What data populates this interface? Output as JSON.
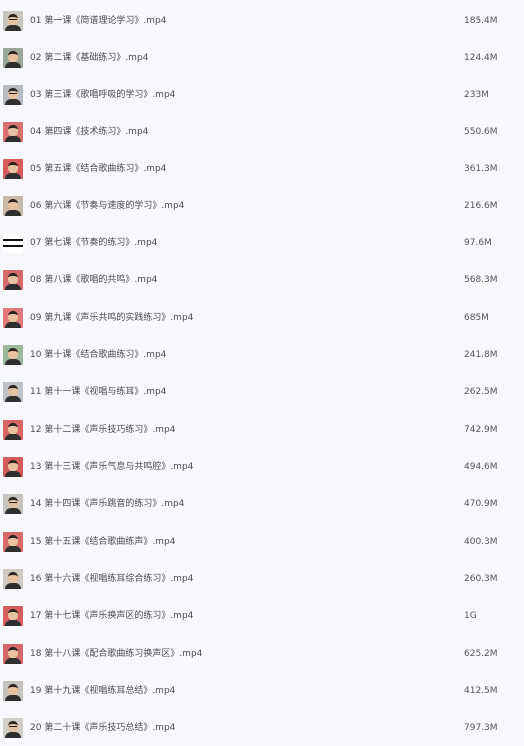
{
  "files": [
    {
      "name": "01 第一课《简谱理论学习》.mp4",
      "size": "185.4M",
      "thumb": "thumbnail-icon",
      "tone": "#c9c6c0"
    },
    {
      "name": "02 第二课《基础练习》.mp4",
      "size": "124.4M",
      "thumb": "thumbnail-icon",
      "tone": "#9aa79a"
    },
    {
      "name": "03 第三课《歌唱呼吸的学习》.mp4",
      "size": "233M",
      "thumb": "thumbnail-icon",
      "tone": "#b8bcc2"
    },
    {
      "name": "04 第四课《技术练习》.mp4",
      "size": "550.6M",
      "thumb": "thumbnail-icon",
      "tone": "#d97070"
    },
    {
      "name": "05 第五课《结合歌曲练习》.mp4",
      "size": "361.3M",
      "thumb": "thumbnail-icon",
      "tone": "#d85a5a"
    },
    {
      "name": "06 第六课《节奏与速度的学习》.mp4",
      "size": "216.6M",
      "thumb": "thumbnail-icon",
      "tone": "#c9b9a8"
    },
    {
      "name": "07 第七课《节奏的练习》.mp4",
      "size": "97.6M",
      "thumb": "thumbnail-icon",
      "tone": "#ffffff"
    },
    {
      "name": "08 第八课《歌唱的共鸣》.mp4",
      "size": "568.3M",
      "thumb": "thumbnail-icon",
      "tone": "#d46a6a"
    },
    {
      "name": "09 第九课《声乐共鸣的实践练习》.mp4",
      "size": "685M",
      "thumb": "thumbnail-icon",
      "tone": "#e07a7a"
    },
    {
      "name": "10 第十课《结合歌曲练习》.mp4",
      "size": "241.8M",
      "thumb": "thumbnail-icon",
      "tone": "#9cb89c"
    },
    {
      "name": "11 第十一课《视唱与练耳》.mp4",
      "size": "262.5M",
      "thumb": "thumbnail-icon",
      "tone": "#bfc3c8"
    },
    {
      "name": "12 第十二课《声乐技巧练习》.mp4",
      "size": "742.9M",
      "thumb": "thumbnail-icon",
      "tone": "#d96464"
    },
    {
      "name": "13 第十三课《声乐气息与共鸣腔》.mp4",
      "size": "494.6M",
      "thumb": "thumbnail-icon",
      "tone": "#d45c5c"
    },
    {
      "name": "14 第十四课《声乐跳音的练习》.mp4",
      "size": "470.9M",
      "thumb": "thumbnail-icon",
      "tone": "#c8c4c0"
    },
    {
      "name": "15 第十五课《结合歌曲练声》.mp4",
      "size": "400.3M",
      "thumb": "thumbnail-icon",
      "tone": "#d86a6a"
    },
    {
      "name": "16 第十六课《视唱练耳综合练习》.mp4",
      "size": "260.3M",
      "thumb": "thumbnail-icon",
      "tone": "#cfcac2"
    },
    {
      "name": "17 第十七课《声乐换声区的练习》.mp4",
      "size": "1G",
      "thumb": "thumbnail-icon",
      "tone": "#d65e5e"
    },
    {
      "name": "18 第十八课《配合歌曲练习换声区》.mp4",
      "size": "625.2M",
      "thumb": "thumbnail-icon",
      "tone": "#d36868"
    },
    {
      "name": "19 第十九课《视唱练耳总结》.mp4",
      "size": "412.5M",
      "thumb": "thumbnail-icon",
      "tone": "#c6c2be"
    },
    {
      "name": "20 第二十课《声乐技巧总结》.mp4",
      "size": "797.3M",
      "thumb": "thumbnail-icon",
      "tone": "#d2cec8"
    }
  ]
}
